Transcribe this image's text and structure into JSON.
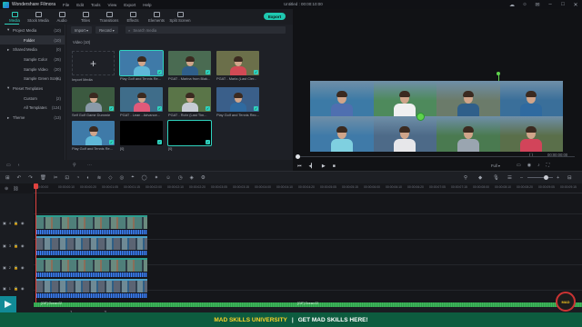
{
  "titlebar": {
    "app_name": "Wondershare Filmora",
    "menus": [
      "File",
      "Edit",
      "Tools",
      "View",
      "Export",
      "Help"
    ],
    "document": "Untitled : 00:00:10:00"
  },
  "tabs": [
    {
      "label": "Media",
      "icon": "media-icon"
    },
    {
      "label": "Stock Media",
      "icon": "stock-media-icon"
    },
    {
      "label": "Audio",
      "icon": "audio-icon"
    },
    {
      "label": "Titles",
      "icon": "titles-icon"
    },
    {
      "label": "Transitions",
      "icon": "transitions-icon"
    },
    {
      "label": "Effects",
      "icon": "effects-icon"
    },
    {
      "label": "Elements",
      "icon": "elements-icon"
    },
    {
      "label": "Split Screen",
      "icon": "split-screen-icon"
    }
  ],
  "export_label": "Export",
  "sidebar": {
    "items": [
      {
        "label": "Project Media",
        "count": "(10)",
        "indent": 0,
        "arrow": "▾"
      },
      {
        "label": "Folder",
        "count": "(10)",
        "indent": 1,
        "arrow": "",
        "selected": true
      },
      {
        "label": "Shared Media",
        "count": "(0)",
        "indent": 0,
        "arrow": "▸"
      },
      {
        "label": "Sample Color",
        "count": "(25)",
        "indent": 1,
        "arrow": ""
      },
      {
        "label": "Sample Video",
        "count": "(20)",
        "indent": 1,
        "arrow": ""
      },
      {
        "label": "Sample Green Scre...",
        "count": "(6)",
        "indent": 1,
        "arrow": ""
      },
      {
        "label": "Preset Templates",
        "count": "",
        "indent": 0,
        "arrow": "▾"
      },
      {
        "label": "Custom",
        "count": "(2)",
        "indent": 1,
        "arrow": ""
      },
      {
        "label": "All Templates",
        "count": "(124)",
        "indent": 1,
        "arrow": ""
      },
      {
        "label": "Theme",
        "count": "(13)",
        "indent": 0,
        "arrow": "▸"
      }
    ]
  },
  "media_toolbar": {
    "import_label": "Import",
    "record_label": "Record",
    "search_placeholder": "Search media"
  },
  "folder_label": "Video (10)",
  "import_media_label": "Import Media",
  "clips": [
    {
      "name": "Play Golf and Tennis Re...",
      "shirt": "#5fb8d8",
      "court": "#3f7aa8",
      "selected": true
    },
    {
      "name": "PGAT - Marina from Blak...",
      "shirt": "#2f5f8a",
      "court": "#4a6b52",
      "selected": false
    },
    {
      "name": "PGAT - Marla (Last Cler...",
      "shirt": "#d24a55",
      "court": "#6b6f4a",
      "selected": false
    },
    {
      "name": "Self Golf Game Dummie",
      "shirt": "#8a9aa8",
      "court": "#3c5a40",
      "selected": false
    },
    {
      "name": "PGAT - Lean - Advance...",
      "shirt": "#e05a7a",
      "court": "#3f6d8a",
      "selected": false
    },
    {
      "name": "PGAT - Rohr (Last Tim...",
      "shirt": "#c6ccd4",
      "court": "#5a7548",
      "selected": false
    },
    {
      "name": "Play Golf and Tennis Rec...",
      "shirt": "#2f6aa0",
      "court": "#3a5f8a",
      "selected": false
    },
    {
      "name": "Play Golf and Tennis Re...",
      "shirt": "#5fb8d8",
      "court": "#3f7aa8",
      "selected": false
    },
    {
      "name": "[0]",
      "shirt": "",
      "court": "#000000",
      "selected": false
    },
    {
      "name": "[0]",
      "shirt": "",
      "court": "#000000",
      "selected": true
    }
  ],
  "viewer_cells": [
    {
      "shirt": "#4f6fb0",
      "court": "#3c7aa6"
    },
    {
      "shirt": "#f0f0f0",
      "court": "#4e8a5c"
    },
    {
      "shirt": "#2f5f8a",
      "court": "#6b7b6a"
    },
    {
      "shirt": "#2f6aa0",
      "court": "#3a6f9a"
    },
    {
      "shirt": "#7fd0e0",
      "court": "#3f7aa8"
    },
    {
      "shirt": "#e7e7ea",
      "court": "#4d6a88"
    },
    {
      "shirt": "#9aa5b0",
      "court": "#4a7a50"
    },
    {
      "shirt": "#d2445a",
      "court": "#5a6f4a"
    }
  ],
  "player": {
    "timecode": "00:00:00:00",
    "time_current": "00:00:00:00",
    "quality": "Full",
    "brackets": "{   }"
  },
  "ruler_ticks": [
    "00:00:00",
    "00:00:00:10",
    "00:00:00:20",
    "00:00:01:05",
    "00:00:01:15",
    "00:00:02:00",
    "00:00:02:10",
    "00:00:02:20",
    "00:00:03:05",
    "00:00:03:15",
    "00:00:04:00",
    "00:00:04:10",
    "00:00:04:20",
    "00:00:05:05",
    "00:00:05:15",
    "00:00:06:00",
    "00:00:06:10",
    "00:00:06:20",
    "00:00:07:05",
    "00:00:07:15",
    "00:00:08:00",
    "00:00:08:10",
    "00:00:08:20",
    "00:00:09:05",
    "00:00:09:15"
  ],
  "track_labels": [
    "4",
    "3",
    "2",
    "1"
  ],
  "music": {
    "left_label": "[GIF] Ocean 02",
    "right_label": "[GIF] Ocean 02"
  },
  "pages": [
    "1",
    "2",
    "3"
  ],
  "banner": {
    "left": "MAD SKILLS UNIVERSITY",
    "separator": "|",
    "right": "GET MAD SKILLS HERE!"
  },
  "logo_right_text": "MAD"
}
